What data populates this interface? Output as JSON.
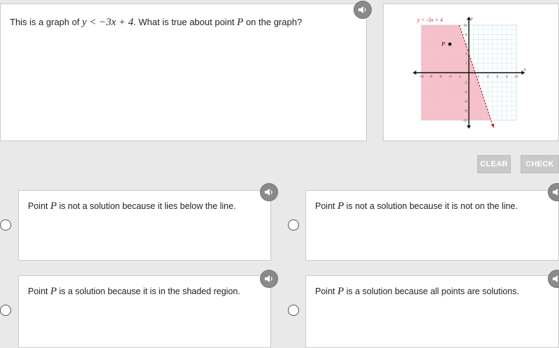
{
  "question": {
    "text_before": "This is a graph of ",
    "inequality": "y < −3x + 4",
    "text_middle": ". What is true about point ",
    "point": "P",
    "text_after": " on the graph?"
  },
  "graph": {
    "label": "y < -3x + 4",
    "point_label": "P",
    "x_axis_label": "x",
    "y_axis_label": "y",
    "x_ticks": [
      "-10",
      "-8",
      "-6",
      "-4",
      "-2",
      "2",
      "4",
      "6",
      "8",
      "10"
    ],
    "y_ticks": [
      "10",
      "8",
      "6",
      "4",
      "2",
      "-2",
      "-4",
      "-6",
      "-8",
      "-10"
    ],
    "point": {
      "x": -4,
      "y": 6
    },
    "line": {
      "slope": -3,
      "intercept": 4,
      "dashed": true
    },
    "shade": "below",
    "colors": {
      "shade": "#f4aab4",
      "line": "#c02a3e",
      "grid": "#a8d4e6",
      "label": "#c02a3e"
    }
  },
  "controls": {
    "clear_label": "CLEAR",
    "check_label": "CHECK"
  },
  "choices": [
    {
      "prefix": "Point ",
      "point": "P",
      "suffix": " is not a solution because it lies below the line."
    },
    {
      "prefix": "Point ",
      "point": "P",
      "suffix": " is not a solution because it is not on the line."
    },
    {
      "prefix": "Point ",
      "point": "P",
      "suffix": " is a solution because it is in the shaded region."
    },
    {
      "prefix": "Point ",
      "point": "P",
      "suffix": " is a solution because all points are solutions."
    }
  ],
  "icons": {
    "audio": "speaker-icon"
  }
}
